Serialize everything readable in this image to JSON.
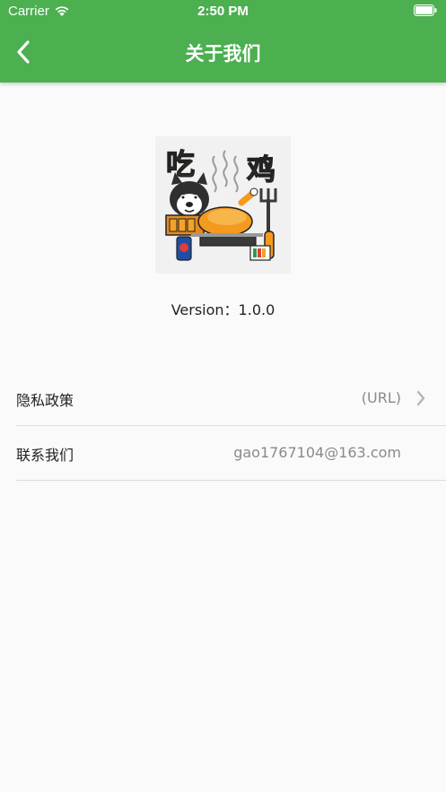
{
  "status_bar": {
    "carrier": "Carrier",
    "time": "2:50 PM",
    "icons": [
      "wifi-icon",
      "battery-icon"
    ]
  },
  "nav": {
    "title": "关于我们",
    "back_icon": "chevron-left-icon"
  },
  "about": {
    "logo_text_left": "吃",
    "logo_text_right": "鸡",
    "version": "Version：1.0.0"
  },
  "list": {
    "items": [
      {
        "label": "隐私政策",
        "value": "(URL)",
        "icon": "chevron-right-icon"
      },
      {
        "label": "联系我们",
        "value": "gao1767104@163.com"
      }
    ]
  },
  "colors": {
    "header": "#4caf50",
    "background": "#fafafa",
    "divider": "#dcdcdc",
    "value_text": "#8a8a8a"
  }
}
